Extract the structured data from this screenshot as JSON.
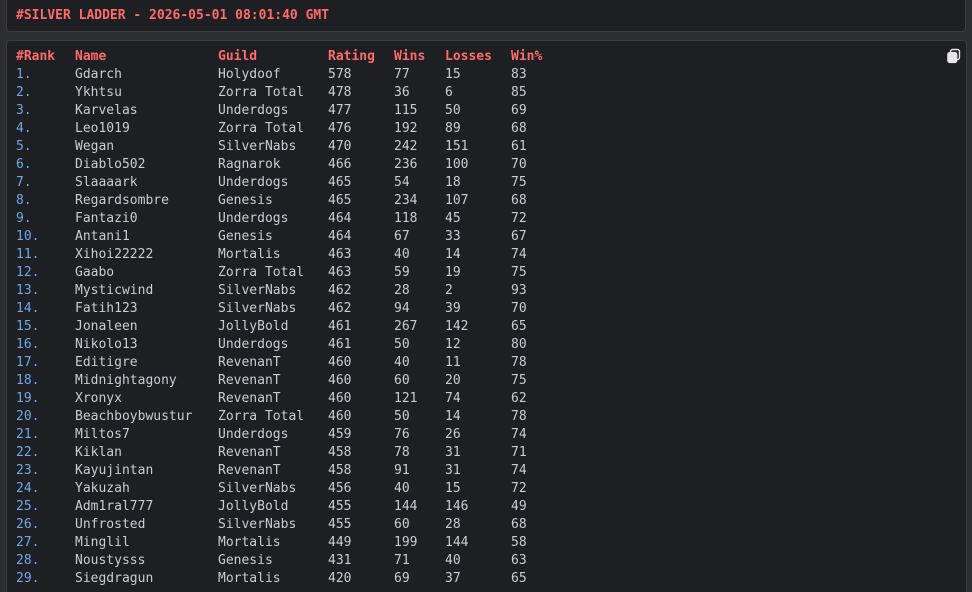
{
  "header": {
    "title": "#SILVER LADDER - 2026-05-01 08:01:40 GMT"
  },
  "copy_button": {
    "icon": "copy-icon"
  },
  "columns": [
    "#Rank",
    "Name",
    "Guild",
    "Rating",
    "Wins",
    "Losses",
    "Win%"
  ],
  "rows": [
    {
      "rank": "1.",
      "name": "Gdarch",
      "guild": "Holydoof",
      "rating": "578",
      "wins": "77",
      "losses": "15",
      "pct": "83"
    },
    {
      "rank": "2.",
      "name": "Ykhtsu",
      "guild": "Zorra Total",
      "rating": "478",
      "wins": "36",
      "losses": "6",
      "pct": "85"
    },
    {
      "rank": "3.",
      "name": "Karvelas",
      "guild": "Underdogs",
      "rating": "477",
      "wins": "115",
      "losses": "50",
      "pct": "69"
    },
    {
      "rank": "4.",
      "name": "Leo1019",
      "guild": "Zorra Total",
      "rating": "476",
      "wins": "192",
      "losses": "89",
      "pct": "68"
    },
    {
      "rank": "5.",
      "name": "Wegan",
      "guild": "SilverNabs",
      "rating": "470",
      "wins": "242",
      "losses": "151",
      "pct": "61"
    },
    {
      "rank": "6.",
      "name": "Diablo502",
      "guild": "Ragnarok",
      "rating": "466",
      "wins": "236",
      "losses": "100",
      "pct": "70"
    },
    {
      "rank": "7.",
      "name": "Slaaaark",
      "guild": "Underdogs",
      "rating": "465",
      "wins": "54",
      "losses": "18",
      "pct": "75"
    },
    {
      "rank": "8.",
      "name": "Regardsombre",
      "guild": "Genesis",
      "rating": "465",
      "wins": "234",
      "losses": "107",
      "pct": "68"
    },
    {
      "rank": "9.",
      "name": "Fantazi0",
      "guild": "Underdogs",
      "rating": "464",
      "wins": "118",
      "losses": "45",
      "pct": "72"
    },
    {
      "rank": "10.",
      "name": "Antani1",
      "guild": "Genesis",
      "rating": "464",
      "wins": "67",
      "losses": "33",
      "pct": "67"
    },
    {
      "rank": "11.",
      "name": "Xihoi22222",
      "guild": "Mortalis",
      "rating": "463",
      "wins": "40",
      "losses": "14",
      "pct": "74"
    },
    {
      "rank": "12.",
      "name": "Gaabo",
      "guild": "Zorra Total",
      "rating": "463",
      "wins": "59",
      "losses": "19",
      "pct": "75"
    },
    {
      "rank": "13.",
      "name": "Mysticwind",
      "guild": "SilverNabs",
      "rating": "462",
      "wins": "28",
      "losses": "2",
      "pct": "93"
    },
    {
      "rank": "14.",
      "name": "Fatih123",
      "guild": "SilverNabs",
      "rating": "462",
      "wins": "94",
      "losses": "39",
      "pct": "70"
    },
    {
      "rank": "15.",
      "name": "Jonaleen",
      "guild": "JollyBold",
      "rating": "461",
      "wins": "267",
      "losses": "142",
      "pct": "65"
    },
    {
      "rank": "16.",
      "name": "Nikolo13",
      "guild": "Underdogs",
      "rating": "461",
      "wins": "50",
      "losses": "12",
      "pct": "80"
    },
    {
      "rank": "17.",
      "name": "Editigre",
      "guild": "RevenanT",
      "rating": "460",
      "wins": "40",
      "losses": "11",
      "pct": "78"
    },
    {
      "rank": "18.",
      "name": "Midnightagony",
      "guild": "RevenanT",
      "rating": "460",
      "wins": "60",
      "losses": "20",
      "pct": "75"
    },
    {
      "rank": "19.",
      "name": "Xronyx",
      "guild": "RevenanT",
      "rating": "460",
      "wins": "121",
      "losses": "74",
      "pct": "62"
    },
    {
      "rank": "20.",
      "name": "Beachboybwustur",
      "guild": "Zorra Total",
      "rating": "460",
      "wins": "50",
      "losses": "14",
      "pct": "78"
    },
    {
      "rank": "21.",
      "name": "Miltos7",
      "guild": "Underdogs",
      "rating": "459",
      "wins": "76",
      "losses": "26",
      "pct": "74"
    },
    {
      "rank": "22.",
      "name": "Kiklan",
      "guild": "RevenanT",
      "rating": "458",
      "wins": "78",
      "losses": "31",
      "pct": "71"
    },
    {
      "rank": "23.",
      "name": "Kayujintan",
      "guild": "RevenanT",
      "rating": "458",
      "wins": "91",
      "losses": "31",
      "pct": "74"
    },
    {
      "rank": "24.",
      "name": "Yakuzah",
      "guild": "SilverNabs",
      "rating": "456",
      "wins": "40",
      "losses": "15",
      "pct": "72"
    },
    {
      "rank": "25.",
      "name": "Adm1ral777",
      "guild": "JollyBold",
      "rating": "455",
      "wins": "144",
      "losses": "146",
      "pct": "49"
    },
    {
      "rank": "26.",
      "name": "Unfrosted",
      "guild": "SilverNabs",
      "rating": "455",
      "wins": "60",
      "losses": "28",
      "pct": "68"
    },
    {
      "rank": "27.",
      "name": "Minglil",
      "guild": "Mortalis",
      "rating": "449",
      "wins": "199",
      "losses": "144",
      "pct": "58"
    },
    {
      "rank": "28.",
      "name": "Noustysss",
      "guild": "Genesis",
      "rating": "431",
      "wins": "71",
      "losses": "40",
      "pct": "63"
    },
    {
      "rank": "29.",
      "name": "Siegdragun",
      "guild": "Mortalis",
      "rating": "420",
      "wins": "69",
      "losses": "37",
      "pct": "65"
    }
  ],
  "colors": {
    "header_text": "#ff6b6b",
    "rank_text": "#6fa8e6",
    "body_text": "#c9cdd2",
    "background": "#1e1f22"
  }
}
